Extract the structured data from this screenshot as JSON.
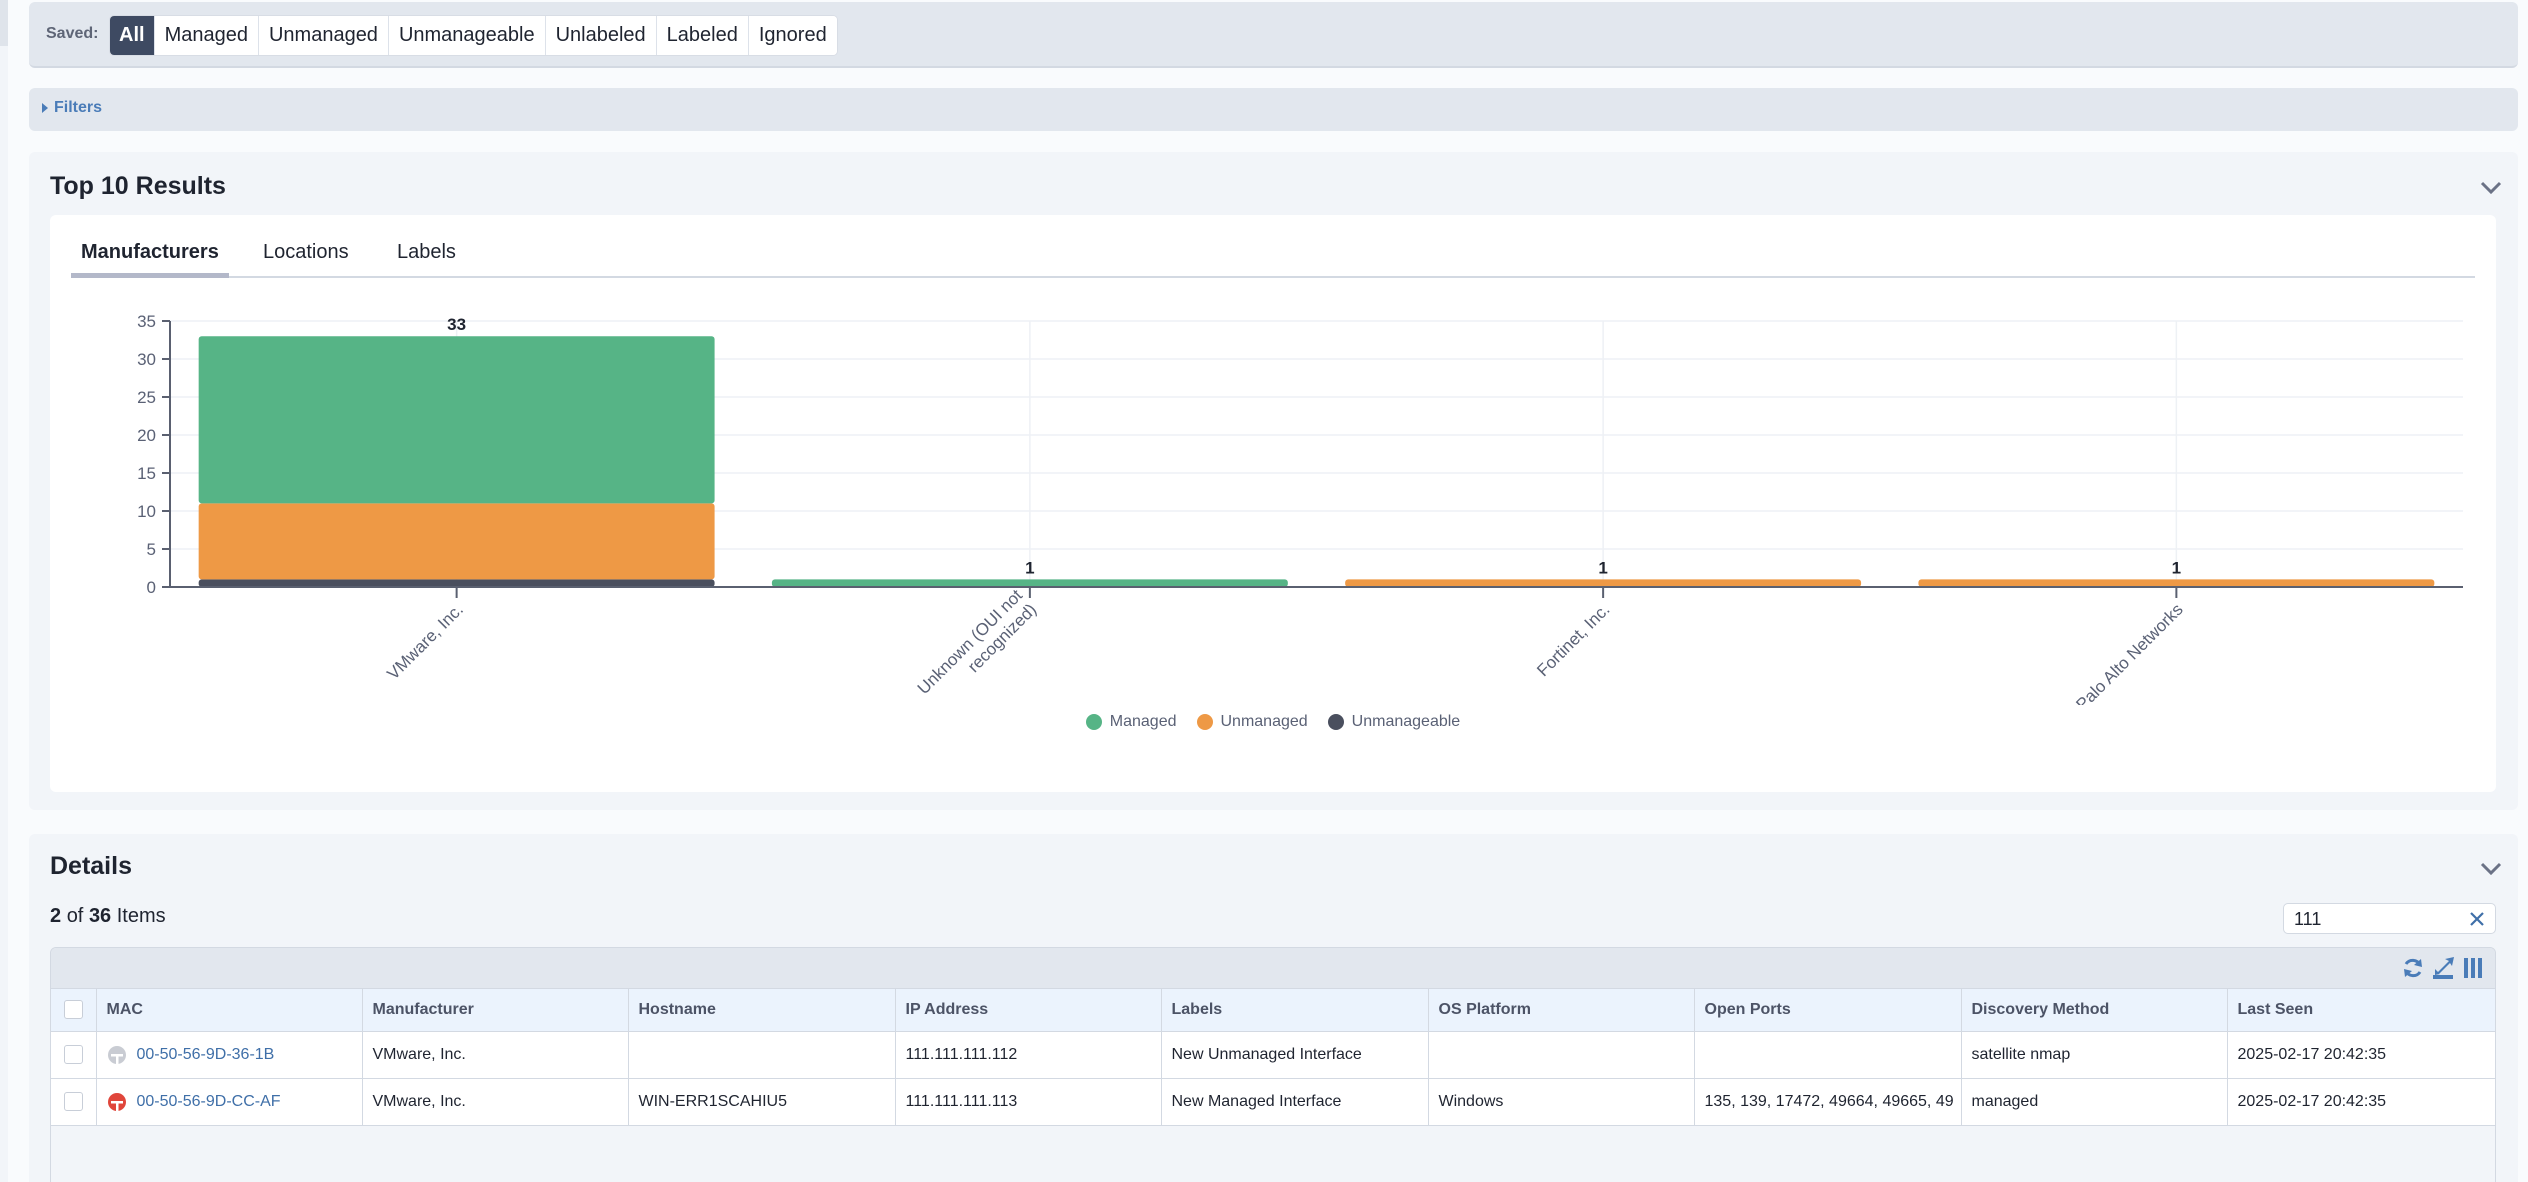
{
  "saved": {
    "label": "Saved:",
    "options": [
      "All",
      "Managed",
      "Unmanaged",
      "Unmanageable",
      "Unlabeled",
      "Labeled",
      "Ignored"
    ],
    "active": "All"
  },
  "filters": {
    "label": "Filters"
  },
  "top10": {
    "title": "Top 10 Results",
    "tabs": [
      "Manufacturers",
      "Locations",
      "Labels"
    ],
    "active_tab": "Manufacturers"
  },
  "colors": {
    "managed": "#56b486",
    "unmanaged": "#ee9945",
    "unmanageable": "#4a4f5e",
    "link": "#3f6fa8",
    "active_button": "#3e4a62"
  },
  "chart_data": {
    "type": "bar",
    "stacked": true,
    "title": "",
    "xlabel": "",
    "ylabel": "",
    "categories": [
      "VMware, Inc.",
      "Unknown (OUI not recognized)",
      "Fortinet, Inc.",
      "Palo Alto Networks"
    ],
    "category_lines": [
      [
        "VMware, Inc."
      ],
      [
        "Unknown (OUI not",
        "recognized)"
      ],
      [
        "Fortinet, Inc."
      ],
      [
        "Palo Alto Networks"
      ]
    ],
    "series": [
      {
        "name": "Unmanageable",
        "color": "#4a4f5e",
        "values": [
          1,
          0,
          0,
          0
        ]
      },
      {
        "name": "Unmanaged",
        "color": "#ee9945",
        "values": [
          10,
          0,
          1,
          1
        ]
      },
      {
        "name": "Managed",
        "color": "#56b486",
        "values": [
          22,
          1,
          0,
          0
        ]
      }
    ],
    "totals": [
      33,
      1,
      1,
      1
    ],
    "legend_order": [
      "Managed",
      "Unmanaged",
      "Unmanageable"
    ],
    "ylim": [
      0,
      35
    ],
    "yticks": [
      0,
      5,
      10,
      15,
      20,
      25,
      30,
      35
    ],
    "grid": true,
    "legend": "bottom-center"
  },
  "details": {
    "title": "Details",
    "shown": "2",
    "of_label": "of",
    "total": "36",
    "items_label": "Items",
    "search_value": "111",
    "columns": [
      "MAC",
      "Manufacturer",
      "Hostname",
      "IP Address",
      "Labels",
      "OS Platform",
      "Open Ports",
      "Discovery Method",
      "Last Seen"
    ],
    "rows": [
      {
        "status": "inactive",
        "mac": "00-50-56-9D-36-1B",
        "manufacturer": "VMware, Inc.",
        "hostname": "",
        "ip": "111.111.111.112",
        "labels": "New Unmanaged Interface",
        "os": "",
        "ports": "",
        "discovery": "satellite nmap",
        "last_seen": "2025-02-17 20:42:35"
      },
      {
        "status": "managed",
        "mac": "00-50-56-9D-CC-AF",
        "manufacturer": "VMware, Inc.",
        "hostname": "WIN-ERR1SCAHIU5",
        "ip": "111.111.111.113",
        "labels": "New Managed Interface",
        "os": "Windows",
        "ports": "135, 139, 17472, 49664, 49665, 49",
        "discovery": "managed",
        "last_seen": "2025-02-17 20:42:35"
      }
    ],
    "toolbar_icons": [
      "refresh-icon",
      "export-icon",
      "columns-icon"
    ]
  }
}
